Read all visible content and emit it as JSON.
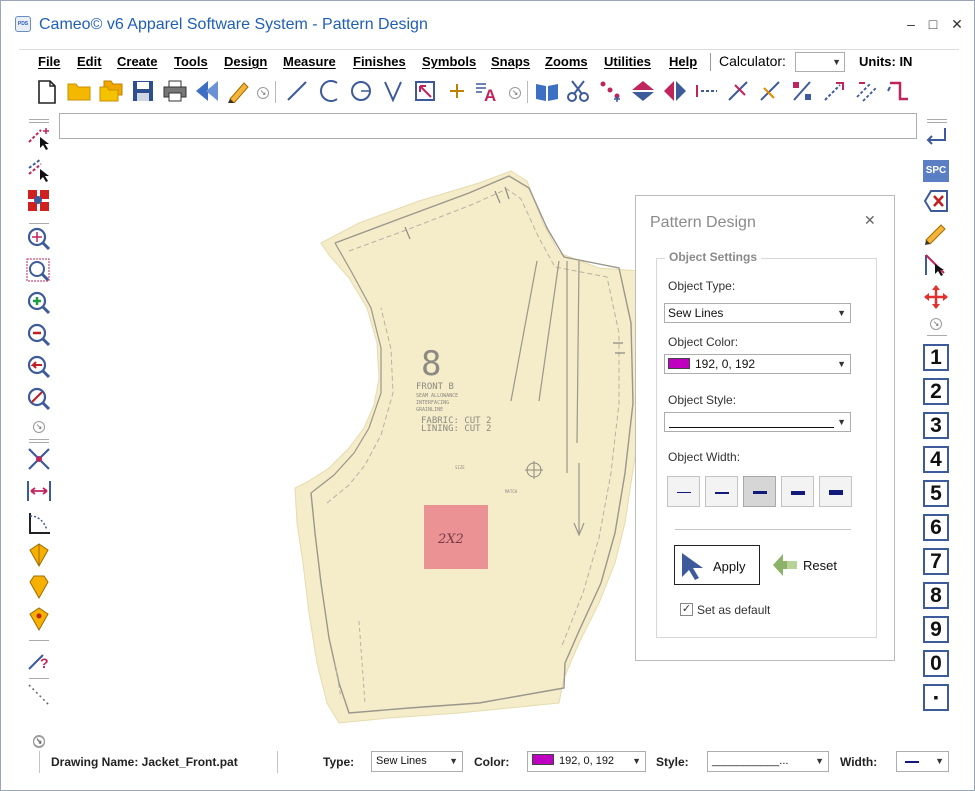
{
  "window": {
    "title": "Cameo© v6 Apparel Software System - Pattern Design",
    "app_icon_text": "PDS",
    "minimize": "–",
    "maximize": "□",
    "close": "✕"
  },
  "menu": {
    "items": [
      "File",
      "Edit",
      "Create",
      "Tools",
      "Design",
      "Measure",
      "Finishes",
      "Symbols",
      "Snaps",
      "Zooms",
      "Utilities",
      "Help"
    ],
    "calculator_label": "Calculator:",
    "calculator_value": "",
    "units": "Units: IN"
  },
  "command_input": {
    "value": ""
  },
  "right_toolbar": {
    "spc_label": "SPC",
    "numbers": [
      "1",
      "2",
      "3",
      "4",
      "5",
      "6",
      "7",
      "8",
      "9",
      "0",
      "▪"
    ]
  },
  "pattern": {
    "size_number": "8",
    "piece_name": "FRONT B",
    "fabric_line": "FABRIC: CUT 2",
    "lining_line": "LINING: CUT 2",
    "label_patch": "2X2"
  },
  "dialog": {
    "title": "Pattern Design",
    "close": "✕",
    "group_label": "Object Settings",
    "type_label": "Object Type:",
    "type_value": "Sew Lines",
    "color_label": "Object Color:",
    "color_value": "192, 0, 192",
    "color_hex": "#c000c0",
    "style_label": "Object Style:",
    "width_label": "Object Width:",
    "apply_label": "Apply",
    "reset_label": "Reset",
    "default_label": "Set as default",
    "default_checked": true
  },
  "status": {
    "drawing_name": "Drawing Name: Jacket_Front.pat",
    "type_label": "Type:",
    "type_value": "Sew Lines",
    "color_label": "Color:",
    "color_value": "192, 0, 192",
    "style_label": "Style:",
    "style_value": "___________...",
    "width_label": "Width:"
  },
  "colors": {
    "title_blue": "#1f5fb5",
    "accent_blue": "#3d5a9a",
    "paper": "#f5ecc9",
    "magenta": "#c000c0",
    "label_red": "#e9828c"
  }
}
